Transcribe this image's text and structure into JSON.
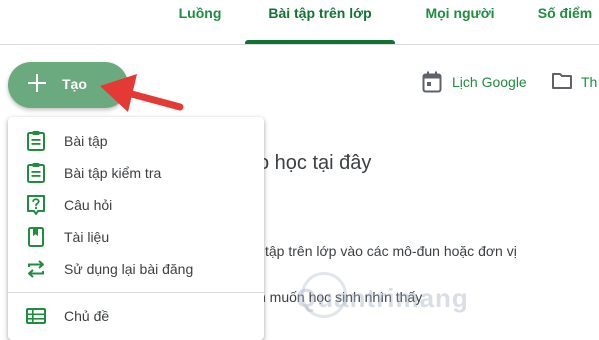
{
  "tabs": [
    {
      "label": "Luồng",
      "active": false
    },
    {
      "label": "Bài tập trên lớp",
      "active": true
    },
    {
      "label": "Mọi người",
      "active": false
    },
    {
      "label": "Số điểm",
      "active": false
    }
  ],
  "toolbar": {
    "create_label": "Tạo",
    "calendar_label": "Lịch Google",
    "folder_label": "Th"
  },
  "menu": {
    "items": [
      {
        "label": "Bài tập",
        "icon": "assignment-icon"
      },
      {
        "label": "Bài tập kiểm tra",
        "icon": "quiz-assignment-icon"
      },
      {
        "label": "Câu hỏi",
        "icon": "question-icon"
      },
      {
        "label": "Tài liệu",
        "icon": "material-icon"
      },
      {
        "label": "Sử dụng lại bài đăng",
        "icon": "reuse-icon"
      }
    ],
    "topic": {
      "label": "Chủ đề",
      "icon": "topic-icon"
    }
  },
  "content": {
    "heading": "o học tại đây",
    "line1": "i tập trên lớp vào các mô-đun hoặc đơn vị",
    "line2": "n muốn học sinh nhìn thấy"
  },
  "watermark": "Quantrimang",
  "colors": {
    "brand_green": "#1e8e3e",
    "create_button": "#6aaa7e",
    "annotation_arrow": "#e53935"
  }
}
